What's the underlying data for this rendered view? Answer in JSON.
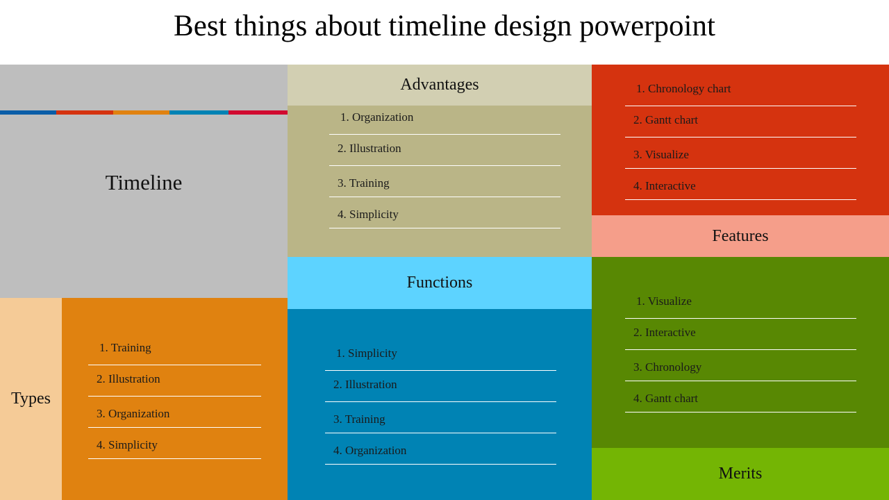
{
  "title": "Best things about timeline design powerpoint",
  "colors": {
    "timeline_bg": "#bebebe",
    "advantages_header": "#d2cfb2",
    "advantages_body": "#bab587",
    "features_list": "#d5330f",
    "features_label": "#f59e8a",
    "merits_list": "#588803",
    "merits_label": "#74b504",
    "types_label": "#f5cb97",
    "types_list": "#e08210",
    "functions_header": "#5dd3ff",
    "functions_body": "#0083b4",
    "stripes": [
      "#0b5ea8",
      "#d5330f",
      "#e08210",
      "#0083b4",
      "#d10a30"
    ]
  },
  "timeline": {
    "label": "Timeline"
  },
  "advantages": {
    "label": "Advantages",
    "items": [
      "1. Organization",
      "2. Illustration",
      "3. Training",
      "4. Simplicity"
    ]
  },
  "features": {
    "label": "Features",
    "items": [
      "1. Chronology chart",
      "2. Gantt chart",
      "3. Visualize",
      "4. Interactive"
    ]
  },
  "types": {
    "label": "Types",
    "items": [
      "1. Training",
      "2. Illustration",
      "3. Organization",
      "4. Simplicity"
    ]
  },
  "functions": {
    "label": "Functions",
    "items": [
      "1. Simplicity",
      "2. Illustration",
      "3. Training",
      "4. Organization"
    ]
  },
  "merits": {
    "label": "Merits",
    "items": [
      "1. Visualize",
      "2. Interactive",
      "3. Chronology",
      "4. Gantt chart"
    ]
  }
}
